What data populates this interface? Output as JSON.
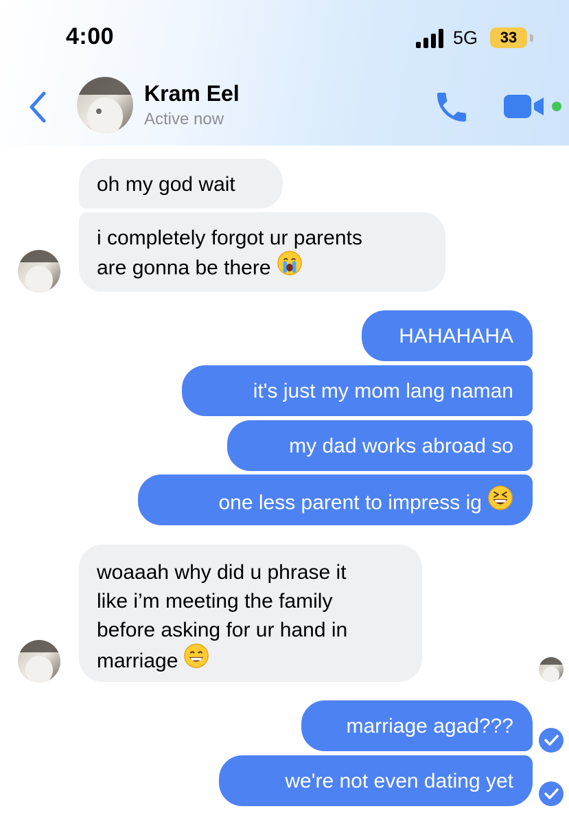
{
  "status_bar": {
    "time": "4:00",
    "network": "5G",
    "battery": "33"
  },
  "header": {
    "contact_name": "Kram Eel",
    "contact_status": "Active now"
  },
  "colors": {
    "outgoing_bubble": "#4d82f3",
    "incoming_bubble": "#eff0f2",
    "accent": "#3b7ff0",
    "online_dot": "#43c55b"
  },
  "icons": {
    "back": "chevron-left-icon",
    "call": "phone-icon",
    "video": "video-camera-icon",
    "read": "check-circle-icon"
  },
  "messages": [
    {
      "direction": "incoming",
      "lines": [
        "oh my god wait"
      ]
    },
    {
      "direction": "incoming",
      "lines": [
        "i completely forgot ur parents",
        "are gonna be there"
      ],
      "emoji": "loudly-crying-face"
    },
    {
      "direction": "outgoing",
      "lines": [
        "HAHAHAHA"
      ]
    },
    {
      "direction": "outgoing",
      "lines": [
        "it's just my mom lang naman"
      ]
    },
    {
      "direction": "outgoing",
      "lines": [
        "my dad works abroad so"
      ]
    },
    {
      "direction": "outgoing",
      "lines": [
        "one less parent to impress ig"
      ],
      "emoji": "grinning-squinting-face"
    },
    {
      "direction": "incoming",
      "lines": [
        "woaaah why did u phrase it",
        "like i’m meeting the family",
        "before asking for ur hand in",
        "marriage"
      ],
      "emoji": "grinning-face-with-smiling-eyes"
    },
    {
      "direction": "outgoing",
      "lines": [
        "marriage agad???"
      ],
      "status": "read"
    },
    {
      "direction": "outgoing",
      "lines": [
        "we're not even dating yet"
      ],
      "status": "read"
    }
  ]
}
